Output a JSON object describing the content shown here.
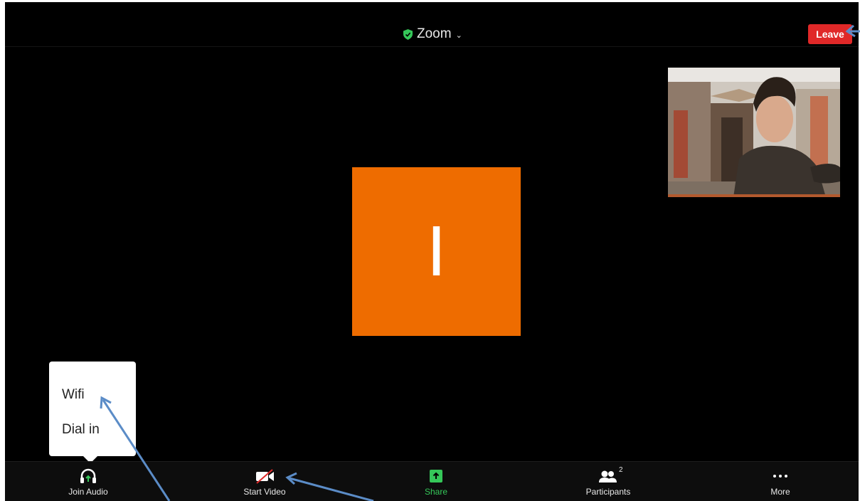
{
  "meeting": {
    "title": "Zoom",
    "leave_label": "Leave",
    "avatar_initial": "I"
  },
  "audio_menu": {
    "items": [
      "Wifi",
      "Dial in"
    ]
  },
  "toolbar": {
    "items": [
      {
        "label": "Join Audio",
        "icon": "headphones-icon"
      },
      {
        "label": "Start Video",
        "icon": "video-off-icon"
      },
      {
        "label": "Share",
        "icon": "share-icon"
      },
      {
        "label": "Participants",
        "icon": "participants-icon",
        "count": "2"
      },
      {
        "label": "More",
        "icon": "more-icon"
      }
    ]
  },
  "colors": {
    "leave": "#e02828",
    "avatar": "#ee6c00",
    "share_green": "#35c759",
    "annotation_arrow": "#5b8cc7"
  }
}
